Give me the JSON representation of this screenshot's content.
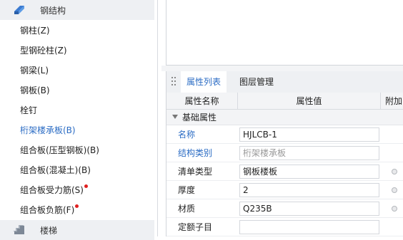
{
  "nav": {
    "group_top": "钢结构",
    "group_bottom": "楼梯",
    "items": [
      {
        "label": "钢柱(Z)",
        "active": false,
        "dot": false
      },
      {
        "label": "型钢砼柱(Z)",
        "active": false,
        "dot": false
      },
      {
        "label": "钢梁(L)",
        "active": false,
        "dot": false
      },
      {
        "label": "钢板(B)",
        "active": false,
        "dot": false
      },
      {
        "label": "栓钉",
        "active": false,
        "dot": false
      },
      {
        "label": "桁架楼承板(B)",
        "active": true,
        "dot": false
      },
      {
        "label": "组合板(压型钢板)(B)",
        "active": false,
        "dot": false
      },
      {
        "label": "组合板(混凝土)(B)",
        "active": false,
        "dot": false
      },
      {
        "label": "组合板受力筋(S)",
        "active": false,
        "dot": true
      },
      {
        "label": "组合板负筋(F)",
        "active": false,
        "dot": true
      }
    ]
  },
  "tabs": {
    "properties": "属性列表",
    "layers": "图层管理"
  },
  "grid": {
    "col_name": "属性名称",
    "col_value": "属性值",
    "col_extra": "附加",
    "section": "基础属性",
    "rows": [
      {
        "name": "名称",
        "value": "HJLCB-1",
        "blue": true,
        "muted": false,
        "radio": false
      },
      {
        "name": "结构类别",
        "value": "桁架楼承板",
        "blue": true,
        "muted": true,
        "radio": false
      },
      {
        "name": "清单类型",
        "value": "钢板楼板",
        "blue": false,
        "muted": false,
        "radio": true
      },
      {
        "name": "厚度",
        "value": "2",
        "blue": false,
        "muted": false,
        "radio": true
      },
      {
        "name": "材质",
        "value": "Q235B",
        "blue": false,
        "muted": false,
        "radio": true
      },
      {
        "name": "定额子目",
        "value": "",
        "blue": false,
        "muted": false,
        "radio": false
      }
    ]
  },
  "colors": {
    "accent": "#2b6cc4",
    "dot": "#e02020"
  },
  "icons": {
    "group_top": "steel-beam-icon",
    "group_bottom": "stairs-icon",
    "grip": "drag-handle-icon",
    "collapse": "collapse-arrow-icon"
  }
}
